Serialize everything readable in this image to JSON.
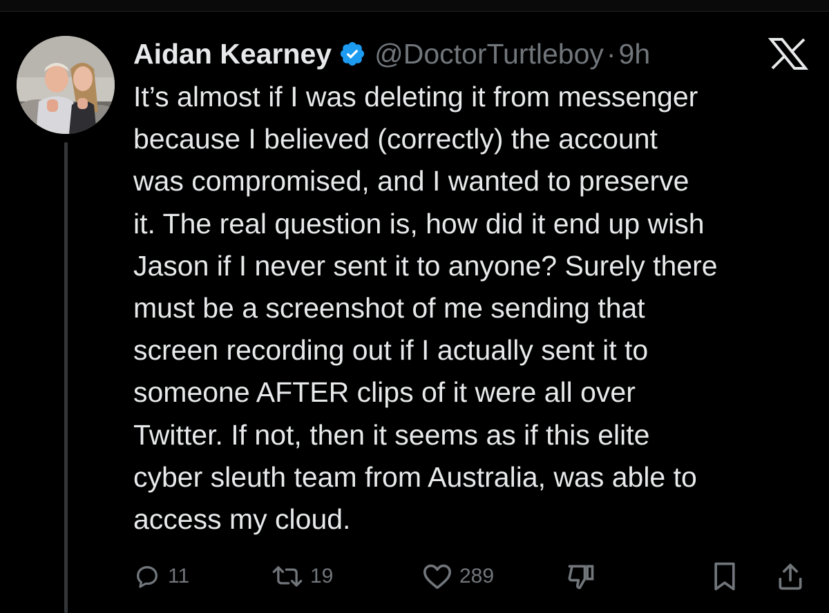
{
  "tweet": {
    "author": {
      "display_name": "Aidan Kearney",
      "handle": "@DoctorTurtleboy",
      "separator": "·",
      "time": "9h",
      "verified": true,
      "avatar_icon": "profile-photo"
    },
    "platform_icon": "x-logo-icon",
    "text_lines": [
      "It’s almost if I was deleting it from messenger",
      "because I believed (correctly) the account",
      "was compromised, and I wanted to preserve",
      "it. The real question is, how did it end up wish",
      "Jason if I never sent it to anyone? Surely there",
      "must be a screenshot of me sending that",
      "screen recording out if I actually sent it to",
      "someone AFTER clips of it were all over",
      "Twitter. If not, then it seems as if this elite",
      "cyber sleuth team from Australia, was able to",
      "access my cloud."
    ],
    "stats": {
      "replies": "11",
      "retweets": "19",
      "likes": "289"
    },
    "action_icons": [
      "reply-icon",
      "retweet-icon",
      "like-icon",
      "dislike-icon",
      "bookmark-icon",
      "share-icon"
    ]
  },
  "colors": {
    "background": "#000000",
    "text": "#e7e9ea",
    "muted": "#71767b",
    "verified": "#1d9bf0",
    "thread_line": "#333639"
  }
}
